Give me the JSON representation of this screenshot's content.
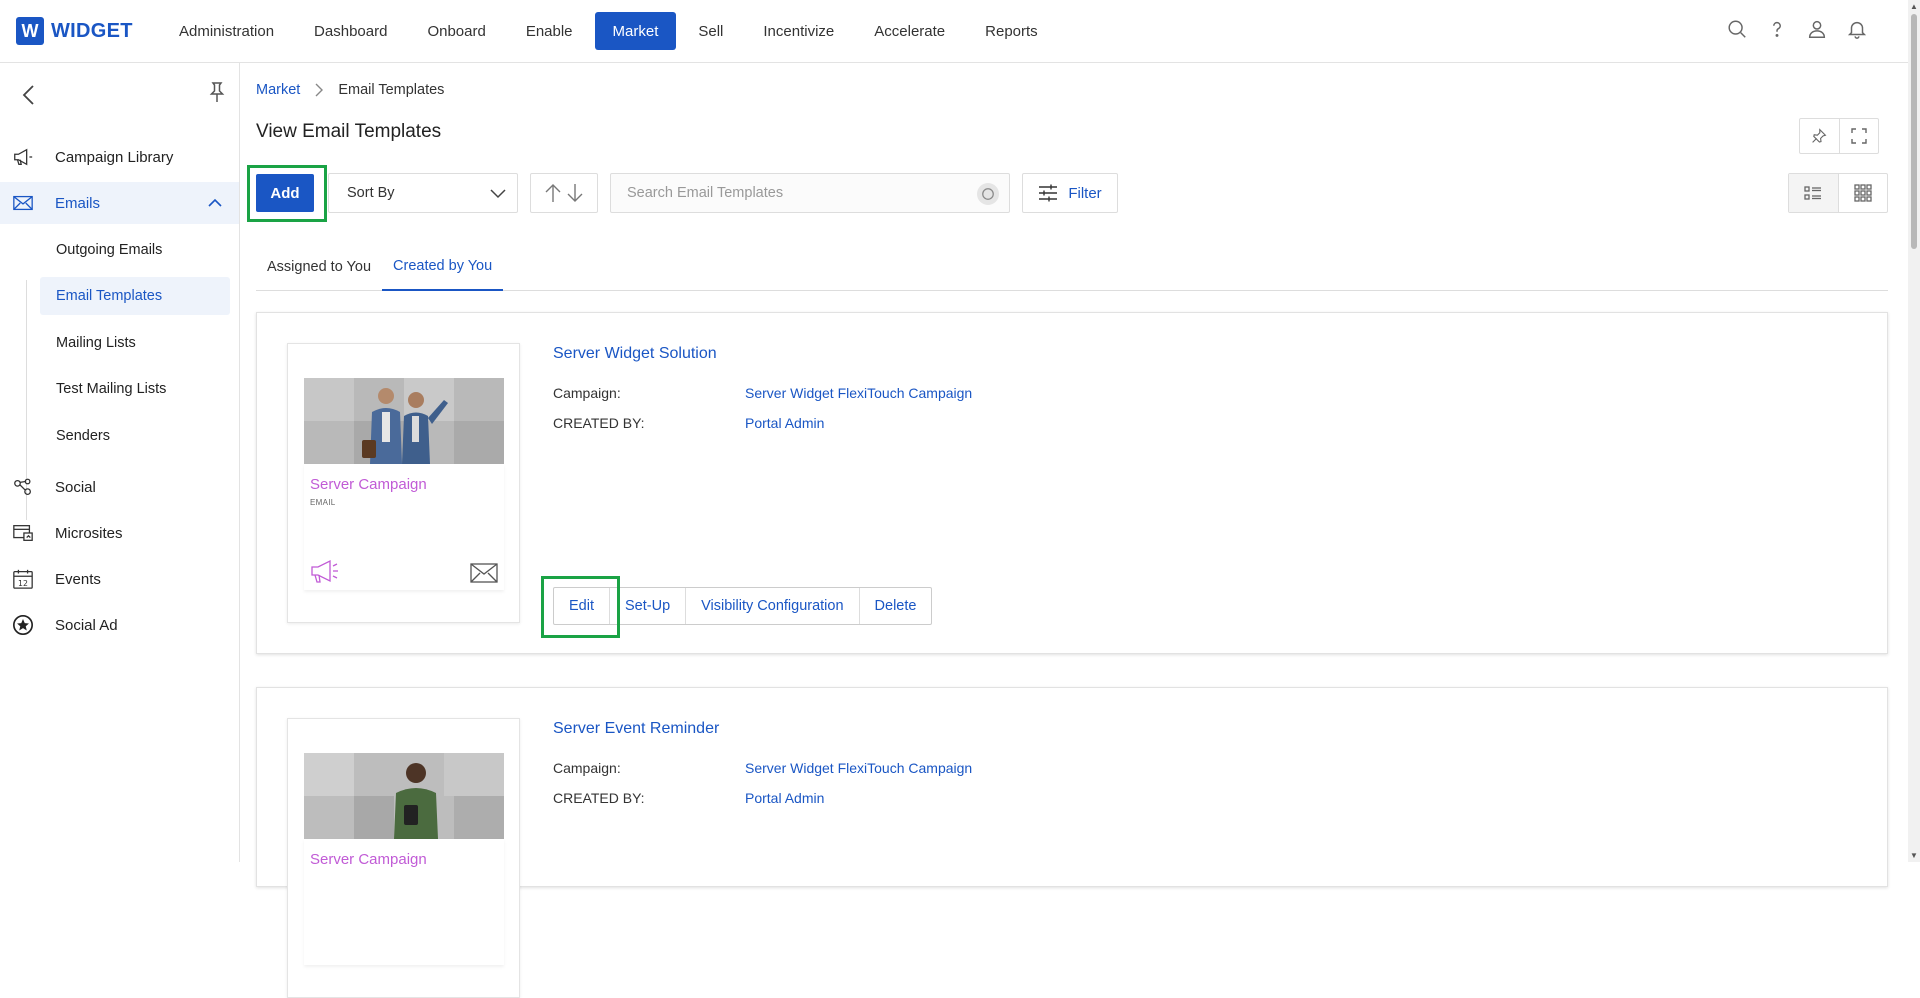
{
  "app": {
    "logo_letter": "W",
    "logo_text": "WIDGET"
  },
  "nav": [
    {
      "label": "Administration"
    },
    {
      "label": "Dashboard"
    },
    {
      "label": "Onboard"
    },
    {
      "label": "Enable"
    },
    {
      "label": "Market",
      "active": true
    },
    {
      "label": "Sell"
    },
    {
      "label": "Incentivize"
    },
    {
      "label": "Accelerate"
    },
    {
      "label": "Reports"
    }
  ],
  "top_icons": [
    "search-icon",
    "help-icon",
    "user-icon",
    "bell-icon"
  ],
  "sidebar": {
    "items": {
      "campaign_library": "Campaign Library",
      "emails": "Emails",
      "social": "Social",
      "microsites": "Microsites",
      "events": "Events",
      "social_ad": "Social Ad"
    },
    "email_sub": {
      "outgoing": "Outgoing Emails",
      "templates": "Email Templates",
      "mailing": "Mailing Lists",
      "test_mailing": "Test Mailing Lists",
      "senders": "Senders"
    },
    "events_day": "12"
  },
  "breadcrumb": {
    "parent": "Market",
    "current": "Email Templates"
  },
  "page": {
    "title": "View Email Templates"
  },
  "toolbar": {
    "add_label": "Add",
    "sort_label": "Sort By",
    "search_placeholder": "Search Email Templates",
    "filter_label": "Filter"
  },
  "tabs": {
    "assigned": "Assigned to You",
    "created": "Created by You",
    "active": "created"
  },
  "templates": [
    {
      "title": "Server Widget Solution",
      "campaign_label": "Campaign:",
      "campaign": "Server Widget FlexiTouch Campaign",
      "created_label": "CREATED BY:",
      "created_by": "Portal Admin",
      "thumb_title": "Server Campaign",
      "thumb_sub": "EMAIL",
      "actions": {
        "edit": "Edit",
        "setup": "Set-Up",
        "visibility": "Visibility Configuration",
        "delete": "Delete"
      }
    },
    {
      "title": "Server Event Reminder",
      "campaign_label": "Campaign:",
      "campaign": "Server Widget FlexiTouch Campaign",
      "created_label": "CREATED BY:",
      "created_by": "Portal Admin",
      "thumb_title": "Server Campaign"
    }
  ],
  "colors": {
    "brand": "#1a56c4",
    "highlight": "#1aa345",
    "thumb_accent": "#c15bd6"
  }
}
